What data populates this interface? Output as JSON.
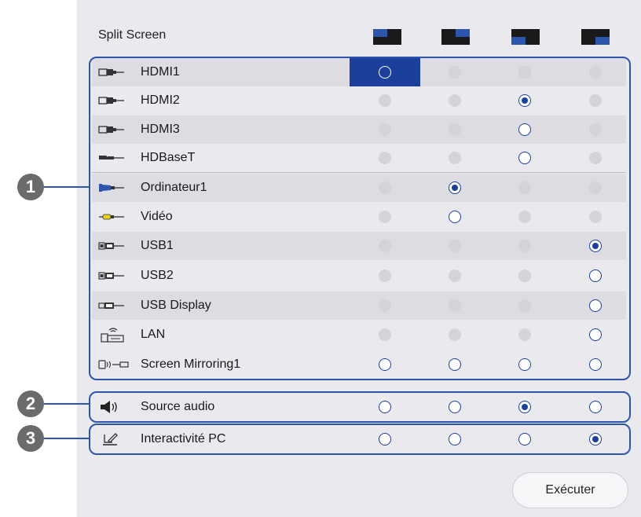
{
  "title": "Split Screen",
  "layouts": [
    "layout-top-left",
    "layout-left",
    "layout-top-right",
    "layout-bottom-right"
  ],
  "sources": [
    {
      "label": "HDMI1",
      "icon": "hdmi-icon",
      "states": [
        "sel",
        "dis",
        "dis",
        "dis"
      ]
    },
    {
      "label": "HDMI2",
      "icon": "hdmi-icon",
      "states": [
        "dis",
        "dis",
        "on",
        "dis"
      ]
    },
    {
      "label": "HDMI3",
      "icon": "hdmi-icon",
      "states": [
        "dis",
        "dis",
        "off",
        "dis"
      ]
    },
    {
      "label": "HDBaseT",
      "icon": "hdbaset-icon",
      "states": [
        "dis",
        "dis",
        "off",
        "dis"
      ]
    },
    {
      "label": "Ordinateur1",
      "icon": "vga-computer-icon",
      "states": [
        "dis",
        "on",
        "dis",
        "dis"
      ]
    },
    {
      "label": "Vidéo",
      "icon": "rca-video-icon",
      "states": [
        "dis",
        "off",
        "dis",
        "dis"
      ]
    },
    {
      "label": "USB1",
      "icon": "usb-icon",
      "states": [
        "dis",
        "dis",
        "dis",
        "on"
      ]
    },
    {
      "label": "USB2",
      "icon": "usb-icon",
      "states": [
        "dis",
        "dis",
        "dis",
        "off"
      ]
    },
    {
      "label": "USB Display",
      "icon": "usb-display-icon",
      "states": [
        "dis",
        "dis",
        "dis",
        "off"
      ]
    },
    {
      "label": "LAN",
      "icon": "lan-icon",
      "states": [
        "dis",
        "dis",
        "dis",
        "off"
      ]
    },
    {
      "label": "Screen Mirroring1",
      "icon": "screen-mirroring-icon",
      "states": [
        "off",
        "off",
        "off",
        "off"
      ]
    }
  ],
  "audio": {
    "label": "Source audio",
    "icon": "speaker-icon",
    "states": [
      "off",
      "off",
      "on",
      "off"
    ]
  },
  "interactive": {
    "label": "Interactivité PC",
    "icon": "pen-tablet-icon",
    "states": [
      "off",
      "off",
      "off",
      "on"
    ]
  },
  "callouts": [
    "1",
    "2",
    "3"
  ],
  "execute_label": "Exécuter",
  "colors": {
    "accent": "#1c3f9b",
    "panel": "#e9e9ee",
    "callout": "#6b6b6b"
  }
}
